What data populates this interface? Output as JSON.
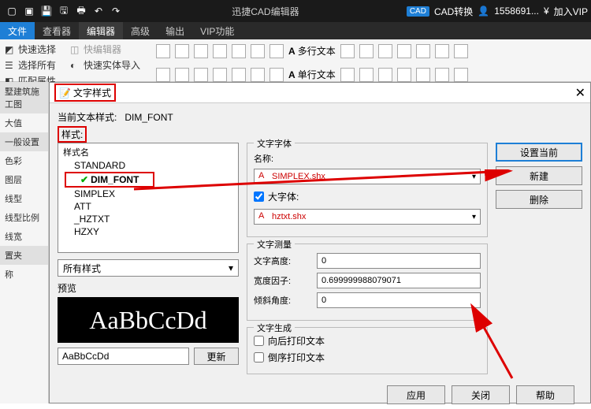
{
  "titlebar": {
    "app": "迅捷CAD编辑器",
    "cad_convert": "CAD转换",
    "user": "1558691...",
    "vip": "加入VIP"
  },
  "menubar": {
    "file": "文件",
    "viewer": "查看器",
    "editor": "编辑器",
    "advanced": "高级",
    "output": "输出",
    "vipfn": "VIP功能"
  },
  "toolbar": {
    "quick_select": "快速选择",
    "quick_edit": "快编辑器",
    "select_all": "选择所有",
    "import_entity": "快速实体导入",
    "match_prop": "匹配属性",
    "multiline_text": "多行文本",
    "singleline_text": "单行文本"
  },
  "left_panel": {
    "title1": "墅建筑施工图",
    "items1": [
      "",
      "大值"
    ],
    "title2": "一般设置",
    "items2": [
      "色彩",
      "图层",
      "线型",
      "线型比例",
      "线宽"
    ],
    "title3": "置夹",
    "items3": [
      "称"
    ]
  },
  "dialog": {
    "title": "文字样式",
    "current_label": "当前文本样式:",
    "current_value": "DIM_FONT",
    "styles_label": "样式:",
    "style_header": "样式名",
    "styles": [
      "STANDARD",
      "DIM_FONT",
      "SIMPLEX",
      "ATT",
      "_HZTXT",
      "HZXY"
    ],
    "all_styles": "所有样式",
    "preview_label": "预览",
    "preview_text": "AaBbCcDd",
    "preview_input": "AaBbCcDd",
    "update_btn": "更新",
    "font_group": "文字字体",
    "name_label": "名称:",
    "name_value": "SIMPLEX.shx",
    "bigfont_cb": "大字体:",
    "bigfont_value": "hztxt.shx",
    "measure_group": "文字测量",
    "height_label": "文字高度:",
    "height_value": "0",
    "width_label": "宽度因子:",
    "width_value": "0.699999988079071",
    "angle_label": "倾斜角度:",
    "angle_value": "0",
    "gen_group": "文字生成",
    "back_print": "向后打印文本",
    "rev_print": "倒序打印文本",
    "set_current": "设置当前",
    "new_btn": "新建",
    "delete_btn": "删除",
    "apply": "应用",
    "close": "关闭",
    "help": "帮助"
  }
}
